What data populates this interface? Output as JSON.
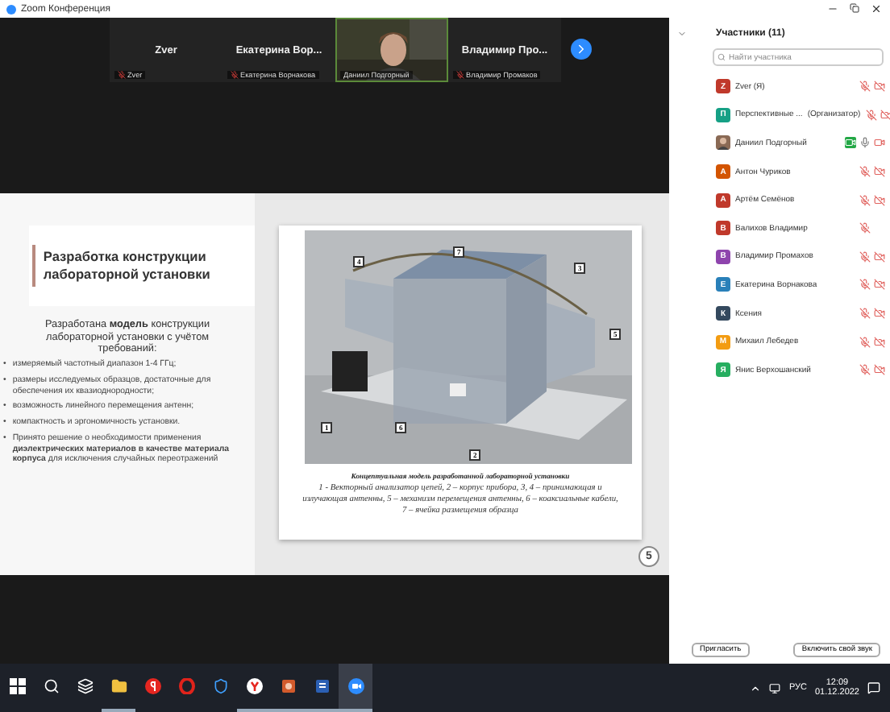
{
  "window": {
    "title": "Zoom Конференция"
  },
  "video_strip": {
    "tiles": [
      {
        "kind": "name",
        "name": "Zver",
        "label": "Zver",
        "muted": true,
        "active_speaker": false
      },
      {
        "kind": "name",
        "name": "Екатерина  Вор...",
        "label": "Екатерина Ворнакова",
        "muted": true,
        "active_speaker": false
      },
      {
        "kind": "video",
        "label": "Даниил Подгорный",
        "muted": false,
        "active_speaker": true
      },
      {
        "kind": "name",
        "name": "Владимир  Про...",
        "label": "Владимир Промаков",
        "muted": true,
        "active_speaker": false
      }
    ]
  },
  "slide": {
    "title": "Разработка конструкции лабораторной установки",
    "intro": "Разработана **модель** конструкции лабораторной установки с учётом требований:",
    "bullets": [
      {
        "marker": "•",
        "text": "измеряемый частотный диапазон 1-4 ГГц;"
      },
      {
        "marker": "•",
        "text": "размеры исследуемых образцов, достаточные для обеспечения их квазиоднородности;"
      },
      {
        "marker": "•",
        "text": "возможность линейного перемещения антенн;"
      },
      {
        "marker": "•",
        "text": "компактность и эргономичность установки."
      },
      {
        "marker": "•",
        "text": "Принято решение о необходимости применения **диэлектрических материалов в качестве материала корпуса** для исключения случайных переотражений"
      }
    ],
    "figure": {
      "callouts": [
        "4",
        "7",
        "3",
        "5",
        "1",
        "6",
        "2"
      ],
      "caption_title": "Концептуальная модель разработанной лабораторной установки",
      "caption": "1 - Векторный анализатор цепей, 2 – корпус прибора, 3, 4 – принимающая и излучающая антенны, 5 – механизм перемещения антенны, 6 – коаксиальные кабели, 7 – ячейка размещения образца"
    },
    "page_number": "5"
  },
  "participants": {
    "title": "Участники (11)",
    "search": {
      "placeholder": "Найти участника"
    },
    "items": [
      {
        "name": "Zver (Я)",
        "avatar": {
          "kind": "letter",
          "letter": "Z",
          "color": "#c0392b"
        },
        "muted": true,
        "camera_shown": true,
        "video_on": false
      },
      {
        "name": "Перспективные ...",
        "role": "(Организатор)",
        "avatar": {
          "kind": "letter",
          "letter": "П",
          "color": "#16a085"
        },
        "muted": true,
        "camera_shown": true,
        "video_on": false
      },
      {
        "name": "Даниил Подгорный",
        "muted": false,
        "camera_shown": true,
        "video_on": true
      },
      {
        "name": "Антон Чуриков",
        "avatar": {
          "kind": "letter",
          "letter": "А",
          "color": "#d35400"
        },
        "muted": true,
        "camera_shown": true,
        "video_on": false
      },
      {
        "name": "Артём Семёнов",
        "avatar": {
          "kind": "letter",
          "letter": "А",
          "color": "#c0392b"
        },
        "muted": true,
        "camera_shown": true,
        "video_on": false
      },
      {
        "name": "Валихов Владимир",
        "avatar": {
          "kind": "letter",
          "letter": "В",
          "color": "#c0392b"
        },
        "muted": true,
        "camera_shown": false,
        "video_on": false
      },
      {
        "name": "Владимир Промахов",
        "avatar": {
          "kind": "letter",
          "letter": "В",
          "color": "#8e44ad"
        },
        "muted": true,
        "camera_shown": true,
        "video_on": false
      },
      {
        "name": "Екатерина Ворнакова",
        "avatar": {
          "kind": "letter",
          "letter": "Е",
          "color": "#2980b9"
        },
        "muted": true,
        "camera_shown": true,
        "video_on": false
      },
      {
        "name": "Ксения",
        "avatar": {
          "kind": "letter",
          "letter": "К",
          "color": "#34495e"
        },
        "muted": true,
        "camera_shown": true,
        "video_on": false
      },
      {
        "name": "Михаил Лебедев",
        "avatar": {
          "kind": "letter",
          "letter": "М",
          "color": "#f39c12"
        },
        "muted": true,
        "camera_shown": true,
        "video_on": false
      },
      {
        "name": "Янис Верхошанский",
        "avatar": {
          "kind": "letter",
          "letter": "Я",
          "color": "#27ae60"
        },
        "muted": true,
        "camera_shown": true,
        "video_on": false
      }
    ],
    "buttons": [
      "Пригласить",
      "Включить свой звук"
    ]
  },
  "taskbar": {
    "apps": [
      {
        "kind": "start",
        "active": false
      },
      {
        "kind": "search",
        "active": false
      },
      {
        "kind": "taskview",
        "active": false
      },
      {
        "kind": "folder",
        "active": true
      },
      {
        "kind": "yandex",
        "active": false
      },
      {
        "kind": "opera",
        "active": false
      },
      {
        "kind": "shield",
        "active": false
      },
      {
        "kind": "browser",
        "active": true
      },
      {
        "kind": "slides",
        "active": true
      },
      {
        "kind": "doc",
        "active": true
      },
      {
        "kind": "zoom",
        "active": true
      }
    ],
    "language": "РУС",
    "time": "12:09",
    "date": "01.12.2022"
  }
}
